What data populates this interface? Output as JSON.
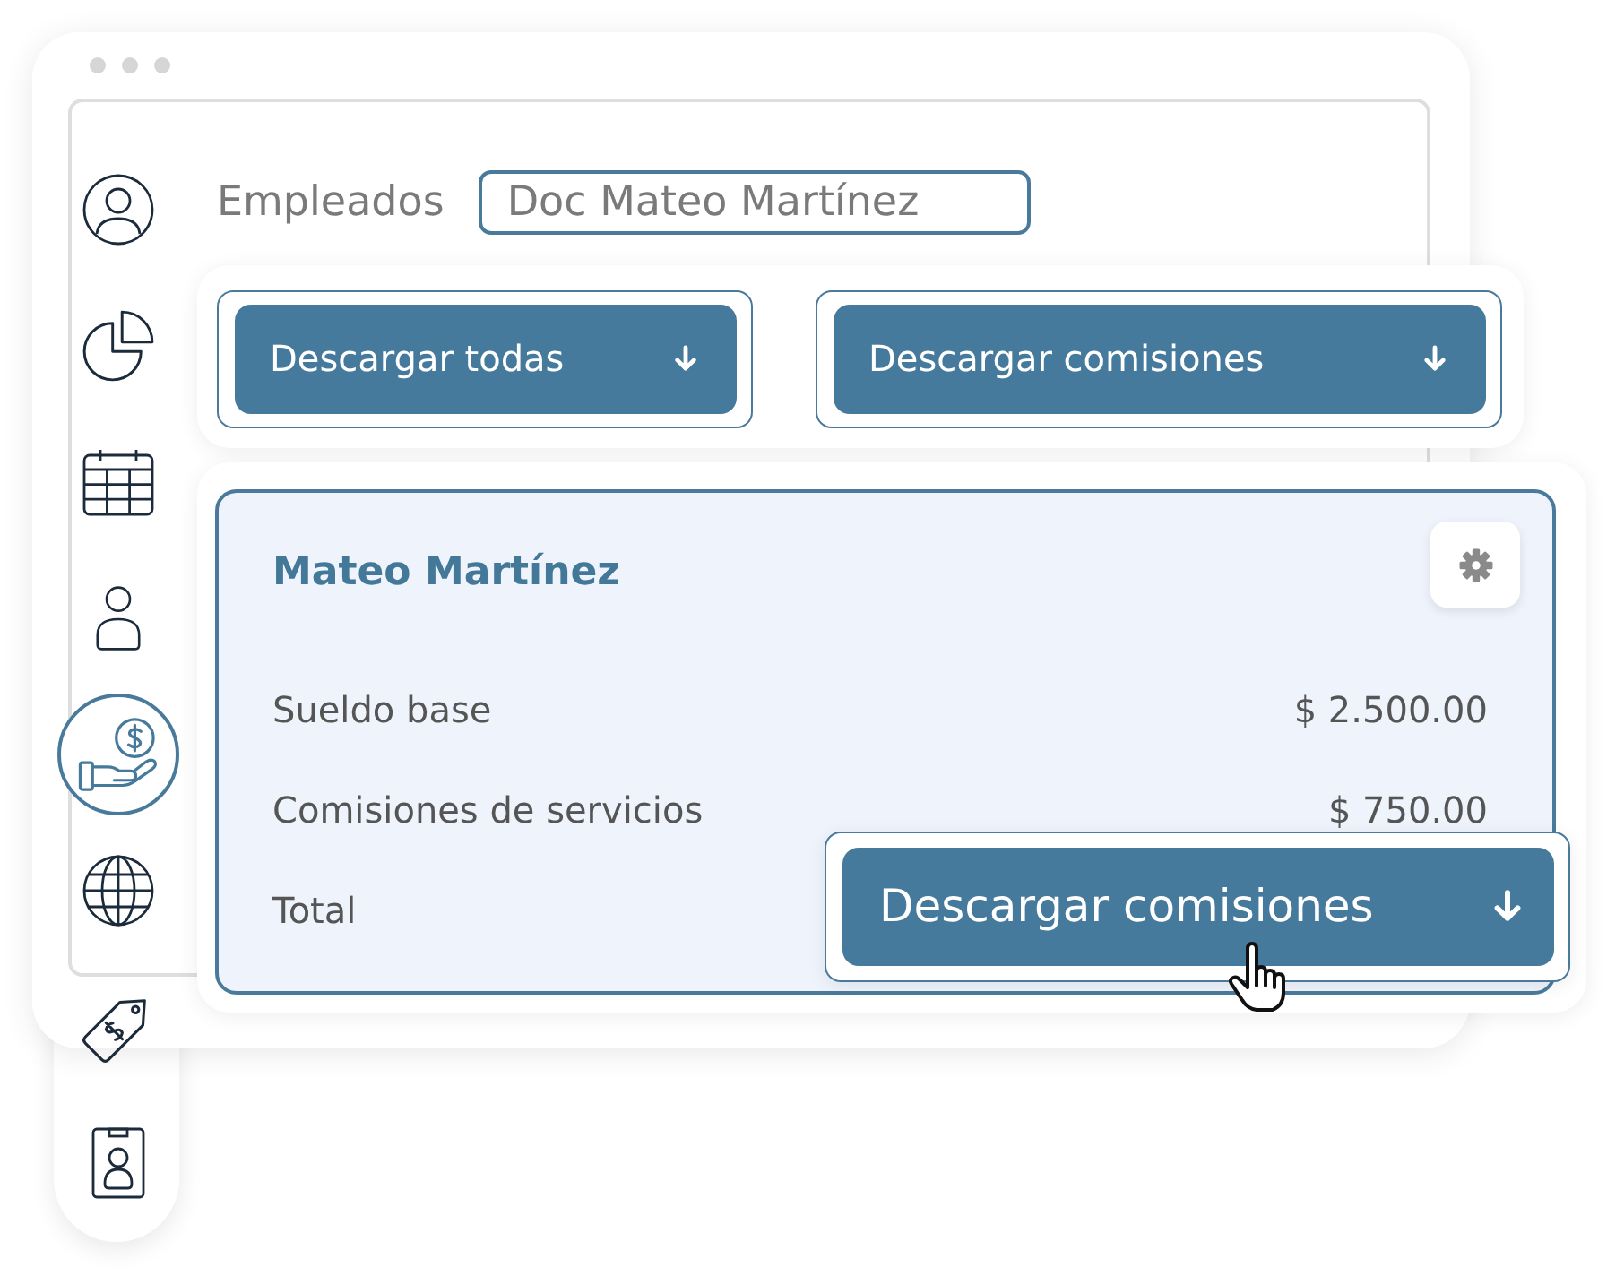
{
  "sidebar": {
    "items": [
      {
        "selected": false
      },
      {
        "selected": false
      },
      {
        "selected": false
      },
      {
        "selected": false
      },
      {
        "selected": true
      },
      {
        "selected": false
      },
      {
        "selected": false
      },
      {
        "selected": false
      }
    ]
  },
  "employee_search": {
    "label": "Empleados",
    "value": "Doc Mateo Martínez"
  },
  "download_buttons": [
    {
      "label": "Descargar todas"
    },
    {
      "label": "Descargar comisiones"
    }
  ],
  "employee_card": {
    "title": "Mateo Martínez",
    "rows": [
      {
        "label": "Sueldo base",
        "value": "$ 2.500.00"
      },
      {
        "label": "Comisiones de servicios",
        "value": "$ 750.00"
      },
      {
        "label": "Total"
      }
    ]
  },
  "floating_button": {
    "label": "Descargar comisiones"
  }
}
